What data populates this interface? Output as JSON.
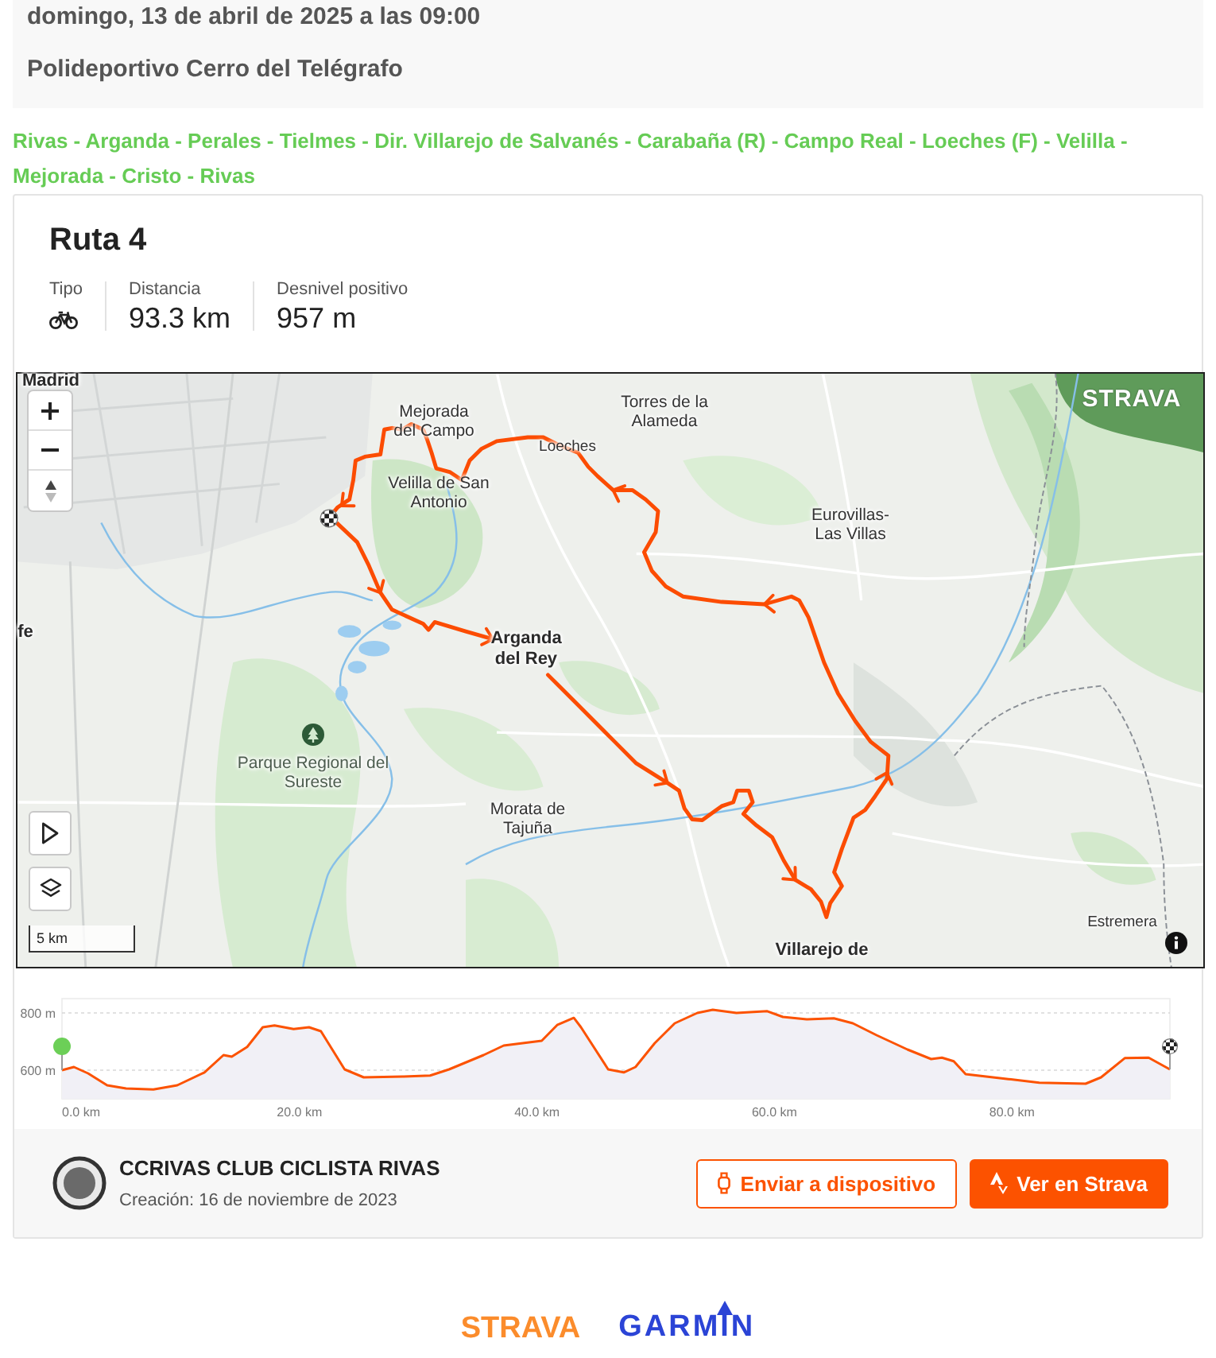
{
  "event": {
    "datetime": "domingo, 13 de abril de 2025 a las 09:00",
    "location": "Polideportivo Cerro del Telégrafo"
  },
  "route_description": "Rivas - Arganda - Perales - Tielmes - Dir. Villarejo de Salvanés - Carabaña (R) - Campo Real - Loeches (F) - Velilla - Mejorada - Cristo - Rivas",
  "route": {
    "title": "Ruta 4",
    "stats": [
      {
        "kind": "icon",
        "label": "Tipo"
      },
      {
        "kind": "text",
        "label": "Distancia",
        "value": "93.3 km"
      },
      {
        "kind": "text",
        "label": "Desnivel positivo",
        "value": "957 m"
      }
    ]
  },
  "map": {
    "logo": "STRAVA",
    "scale": "5 km",
    "labels": [
      {
        "text": "Madrid",
        "kind": "major"
      },
      {
        "text": "Mejorada del Campo",
        "kind": "town"
      },
      {
        "text": "Velilla de San Antonio",
        "kind": "town"
      },
      {
        "text": "Torres de la Alameda",
        "kind": "town"
      },
      {
        "text": "Loeches",
        "kind": "small"
      },
      {
        "text": "Eurovillas-Las Villas",
        "kind": "town"
      },
      {
        "text": "Arganda del Rey",
        "kind": "major"
      },
      {
        "text": "Parque Regional del Sureste",
        "kind": "park"
      },
      {
        "text": "Morata de Tajuña",
        "kind": "town"
      },
      {
        "text": "Villarejo de",
        "kind": "major"
      },
      {
        "text": "Estremera",
        "kind": "small"
      },
      {
        "text": "fe",
        "kind": "major"
      }
    ]
  },
  "elevation": {
    "chart_data": {
      "type": "area",
      "x": [
        0,
        1,
        2.2,
        3.8,
        5.4,
        7.7,
        9.7,
        12,
        13.6,
        14.3,
        15.6,
        16.9,
        17.9,
        19.5,
        20.8,
        21.8,
        23.8,
        25.4,
        28.7,
        31,
        32.6,
        35.5,
        37.2,
        40.4,
        41.7,
        43.1,
        43.7,
        46,
        47.3,
        48.3,
        49.9,
        51.6,
        53.5,
        54.8,
        56.8,
        59.4,
        60.7,
        62.7,
        65,
        66.6,
        68.6,
        71.2,
        73.2,
        74.1,
        75.1,
        76.1,
        79.7,
        82.3,
        86.2,
        87.5,
        89.5,
        91.5,
        93.3
      ],
      "series": [
        {
          "color": "#fc5200",
          "values": [
            600,
            611,
            589,
            547,
            536,
            533,
            547,
            592,
            653,
            647,
            681,
            750,
            756,
            744,
            750,
            736,
            603,
            575,
            578,
            581,
            603,
            653,
            686,
            703,
            758,
            783,
            750,
            603,
            592,
            611,
            694,
            764,
            800,
            811,
            800,
            806,
            786,
            778,
            781,
            764,
            722,
            672,
            639,
            644,
            631,
            586,
            569,
            556,
            553,
            575,
            642,
            644,
            603
          ]
        }
      ],
      "xlim": [
        0,
        93.3
      ],
      "ylim": [
        500,
        850
      ],
      "xticks": [
        {
          "value": 0,
          "label": "0.0 km"
        },
        {
          "value": 20,
          "label": "20.0 km"
        },
        {
          "value": 40,
          "label": "40.0 km"
        },
        {
          "value": 60,
          "label": "60.0 km"
        },
        {
          "value": 80,
          "label": "80.0 km"
        }
      ],
      "yticks": [
        {
          "value": 600,
          "label": "600 m"
        },
        {
          "value": 800,
          "label": "800 m"
        }
      ]
    }
  },
  "club": {
    "name": "CCRIVAS CLUB CICLISTA RIVAS",
    "created": "Creación: 16 de noviembre de 2023"
  },
  "buttons": [
    {
      "label": "Enviar a dispositivo",
      "kind": "outline"
    },
    {
      "label": "Ver en Strava",
      "kind": "primary"
    }
  ],
  "partners": [
    {
      "name": "STRAVA",
      "kind": "strava"
    },
    {
      "name": "GARMIN",
      "kind": "garmin"
    }
  ]
}
